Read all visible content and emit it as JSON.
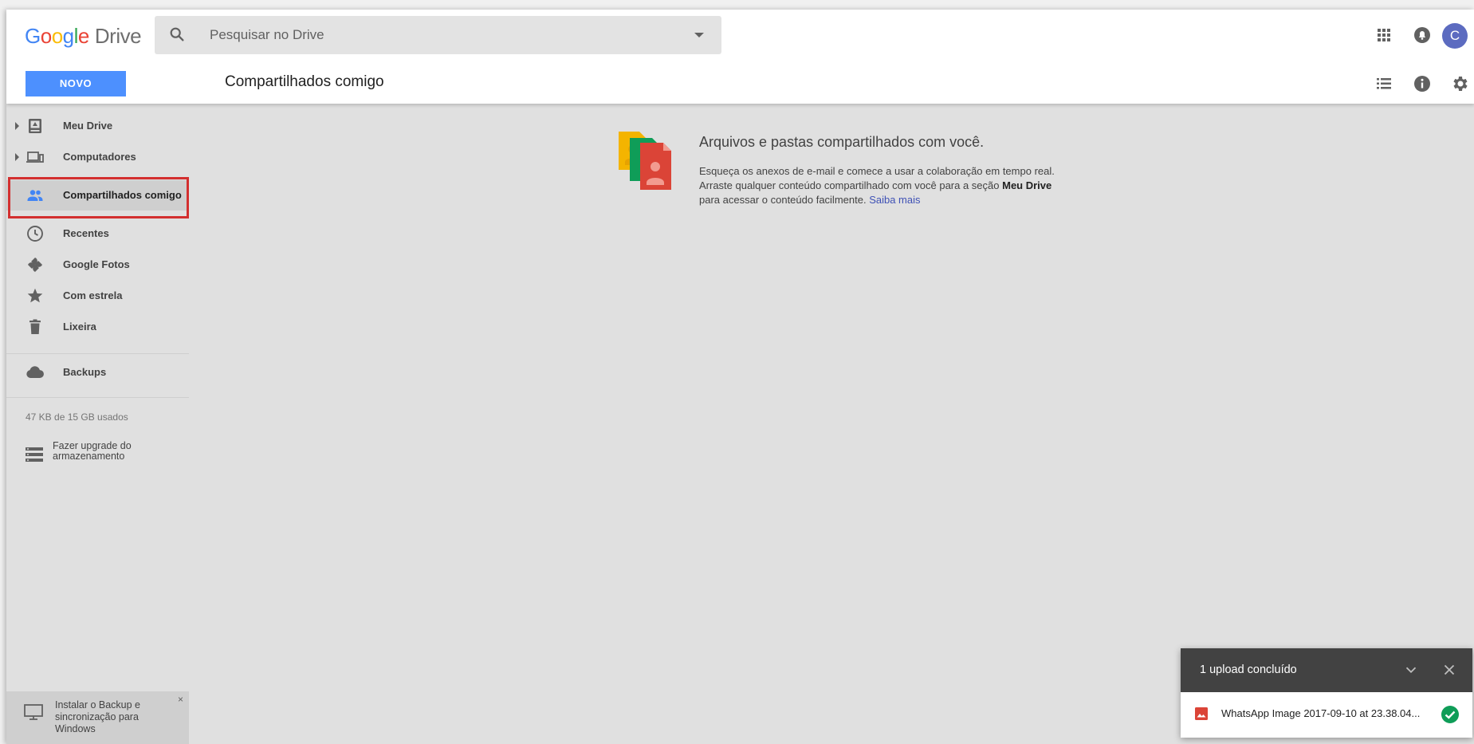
{
  "app": {
    "logo_google": [
      "G",
      "o",
      "o",
      "g",
      "l",
      "e"
    ],
    "logo_drive": "Drive",
    "avatar_letter": "C"
  },
  "search": {
    "placeholder": "Pesquisar no Drive"
  },
  "toolbar": {
    "new_label": "NOVO",
    "page_title": "Compartilhados comigo"
  },
  "sidebar": {
    "items": [
      {
        "label": "Meu Drive",
        "icon": "my-drive-icon",
        "expandable": true
      },
      {
        "label": "Computadores",
        "icon": "computers-icon",
        "expandable": true
      },
      {
        "label": "Compartilhados comigo",
        "icon": "shared-people-icon",
        "active": true
      },
      {
        "label": "Recentes",
        "icon": "clock-icon"
      },
      {
        "label": "Google Fotos",
        "icon": "pinwheel-icon"
      },
      {
        "label": "Com estrela",
        "icon": "star-icon"
      },
      {
        "label": "Lixeira",
        "icon": "trash-icon"
      }
    ],
    "backups_label": "Backups",
    "storage_text": "47 KB de 15 GB usados",
    "upgrade_label_1": "Fazer upgrade do",
    "upgrade_label_2": "armazenamento",
    "install_line_1": "Instalar o Backup e",
    "install_line_2": "sincronização para",
    "install_line_3": "Windows",
    "install_close": "×"
  },
  "empty_state": {
    "title": "Arquivos e pastas compartilhados com você.",
    "line1": "Esqueça os anexos de e-mail e comece a usar a colaboração em tempo real.",
    "line2_pre": "Arraste qualquer conteúdo compartilhado com você para a seção ",
    "line2_bold": "Meu Drive",
    "line3_pre": "para acessar o conteúdo facilmente. ",
    "line3_link": "Saiba mais"
  },
  "upload_panel": {
    "title": "1 upload concluído",
    "file_name": "WhatsApp Image 2017-09-10 at 23.38.04..."
  },
  "colors": {
    "accent_blue": "#4d90fe",
    "highlight_red": "#d32f2f",
    "success_green": "#0f9d58",
    "avatar": "#5c6bc0"
  }
}
